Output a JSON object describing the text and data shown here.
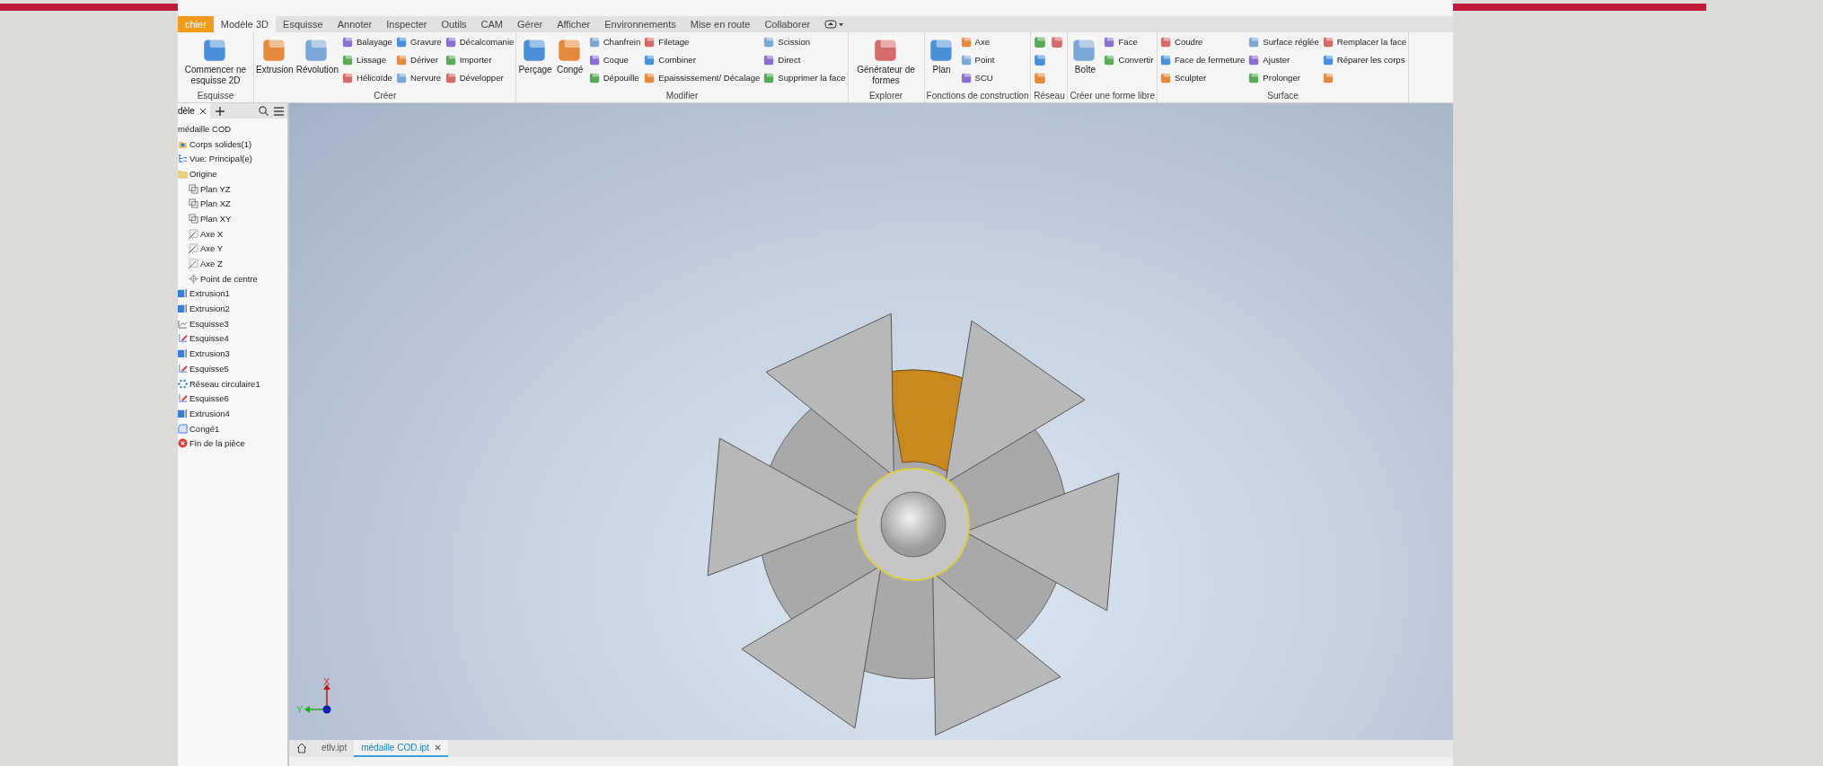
{
  "ribbon_tabs": [
    {
      "label": "chier",
      "kind": "file",
      "selected": false
    },
    {
      "label": "Modèle 3D",
      "kind": "tab",
      "selected": true
    },
    {
      "label": "Esquisse",
      "kind": "tab",
      "selected": false
    },
    {
      "label": "Annoter",
      "kind": "tab",
      "selected": false
    },
    {
      "label": "Inspecter",
      "kind": "tab",
      "selected": false
    },
    {
      "label": "Outils",
      "kind": "tab",
      "selected": false
    },
    {
      "label": "CAM",
      "kind": "tab",
      "selected": false
    },
    {
      "label": "Gérer",
      "kind": "tab",
      "selected": false
    },
    {
      "label": "Afficher",
      "kind": "tab",
      "selected": false
    },
    {
      "label": "Environnements",
      "kind": "tab",
      "selected": false
    },
    {
      "label": "Mise en route",
      "kind": "tab",
      "selected": false
    },
    {
      "label": "Collaborer",
      "kind": "tab",
      "selected": false
    }
  ],
  "ribbon_panels": [
    {
      "title": "Esquisse",
      "kind": "tools",
      "large": [
        {
          "label": "Commencer ne esquisse 2D"
        }
      ]
    },
    {
      "title": "Créer",
      "kind": "tools",
      "large": [
        {
          "label": "Extrusion"
        },
        {
          "label": "Révolution"
        }
      ],
      "columns": [
        [
          {
            "kind": "tool",
            "label": "Balayage"
          },
          {
            "kind": "tool",
            "label": "Lissage"
          },
          {
            "kind": "tool",
            "label": "Hélicoïde"
          }
        ],
        [
          {
            "kind": "tool",
            "label": "Gravure"
          },
          {
            "kind": "tool",
            "label": "Dériver"
          },
          {
            "kind": "tool",
            "label": "Nervure"
          }
        ],
        [
          {
            "kind": "tool",
            "label": "Décalcomanie"
          },
          {
            "kind": "tool",
            "label": "Importer"
          },
          {
            "kind": "tool",
            "label": "Développer"
          }
        ]
      ]
    },
    {
      "title": "Modifier",
      "kind": "tools",
      "large": [
        {
          "label": "Perçage"
        },
        {
          "label": "Congé"
        }
      ],
      "columns": [
        [
          {
            "kind": "tool",
            "label": "Chanfrein"
          },
          {
            "kind": "tool",
            "label": "Coque"
          },
          {
            "kind": "tool",
            "label": "Dépouille"
          }
        ],
        [
          {
            "kind": "tool",
            "label": "Filetage"
          },
          {
            "kind": "tool",
            "label": "Combiner"
          },
          {
            "kind": "tool",
            "label": "Epaississement/ Décalage"
          }
        ],
        [
          {
            "kind": "tool",
            "label": "Scission"
          },
          {
            "kind": "tool",
            "label": "Direct"
          },
          {
            "kind": "tool",
            "label": "Supprimer la face"
          }
        ]
      ]
    },
    {
      "title": "Explorer",
      "kind": "tools",
      "large": [
        {
          "label": "Générateur de formes"
        }
      ]
    },
    {
      "title": "Fonctions de construction",
      "kind": "tools",
      "large": [
        {
          "label": "Plan"
        }
      ],
      "columns": [
        [
          {
            "kind": "tool",
            "label": "Axe"
          },
          {
            "kind": "tool",
            "label": "Point"
          },
          {
            "kind": "tool",
            "label": "SCU"
          }
        ]
      ]
    },
    {
      "title": "Réseau",
      "kind": "icon_grid"
    },
    {
      "title": "Créer une forme libre",
      "kind": "tools",
      "large": [
        {
          "label": "Boîte"
        }
      ],
      "columns": [
        [
          {
            "kind": "tool",
            "label": "Face"
          },
          {
            "kind": "tool",
            "label": "Convertir"
          }
        ]
      ]
    },
    {
      "title": "Surface",
      "kind": "tools",
      "columns": [
        [
          {
            "kind": "tool",
            "label": "Coudre"
          },
          {
            "kind": "tool",
            "label": "Face de fermeture"
          },
          {
            "kind": "tool",
            "label": "Sculpter"
          }
        ],
        [
          {
            "kind": "tool",
            "label": "Surface réglée"
          },
          {
            "kind": "tool",
            "label": "Ajuster"
          },
          {
            "kind": "tool",
            "label": "Prolonger"
          }
        ],
        [
          {
            "kind": "tool",
            "label": "Remplacer la face"
          },
          {
            "kind": "tool",
            "label": "Réparer les corps"
          },
          {
            "kind": "icon"
          }
        ]
      ]
    }
  ],
  "browser": {
    "tab": "dèle",
    "items": [
      {
        "label": "médaille COD",
        "kind": "root"
      },
      {
        "label": "Corps solides(1)",
        "kind": "solids"
      },
      {
        "label": "Vue: Principal(e)",
        "kind": "view"
      },
      {
        "label": "Origine",
        "kind": "folder",
        "children": [
          {
            "label": "Plan YZ",
            "kind": "plane"
          },
          {
            "label": "Plan XZ",
            "kind": "plane"
          },
          {
            "label": "Plan XY",
            "kind": "plane"
          },
          {
            "label": "Axe X",
            "kind": "axis"
          },
          {
            "label": "Axe Y",
            "kind": "axis"
          },
          {
            "label": "Axe Z",
            "kind": "axis"
          },
          {
            "label": "Point de centre",
            "kind": "point"
          }
        ]
      },
      {
        "label": "Extrusion1",
        "kind": "extrusion"
      },
      {
        "label": "Extrusion2",
        "kind": "extrusion"
      },
      {
        "label": "Esquisse3",
        "kind": "sketch3d"
      },
      {
        "label": "Esquisse4",
        "kind": "sketch"
      },
      {
        "label": "Extrusion3",
        "kind": "extrusion"
      },
      {
        "label": "Esquisse5",
        "kind": "sketch"
      },
      {
        "label": "Réseau circulaire1",
        "kind": "pattern"
      },
      {
        "label": "Esquisse6",
        "kind": "sketch"
      },
      {
        "label": "Extrusion4",
        "kind": "extrusion"
      },
      {
        "label": "Congé1",
        "kind": "fillet"
      },
      {
        "label": "Fin de la pièce",
        "kind": "end"
      }
    ]
  },
  "view_axes": {
    "x": "X",
    "y": "Y"
  },
  "document_tabs": [
    {
      "label": "etlv.ipt",
      "selected": false
    },
    {
      "label": "médaille COD.ipt",
      "selected": true
    }
  ]
}
